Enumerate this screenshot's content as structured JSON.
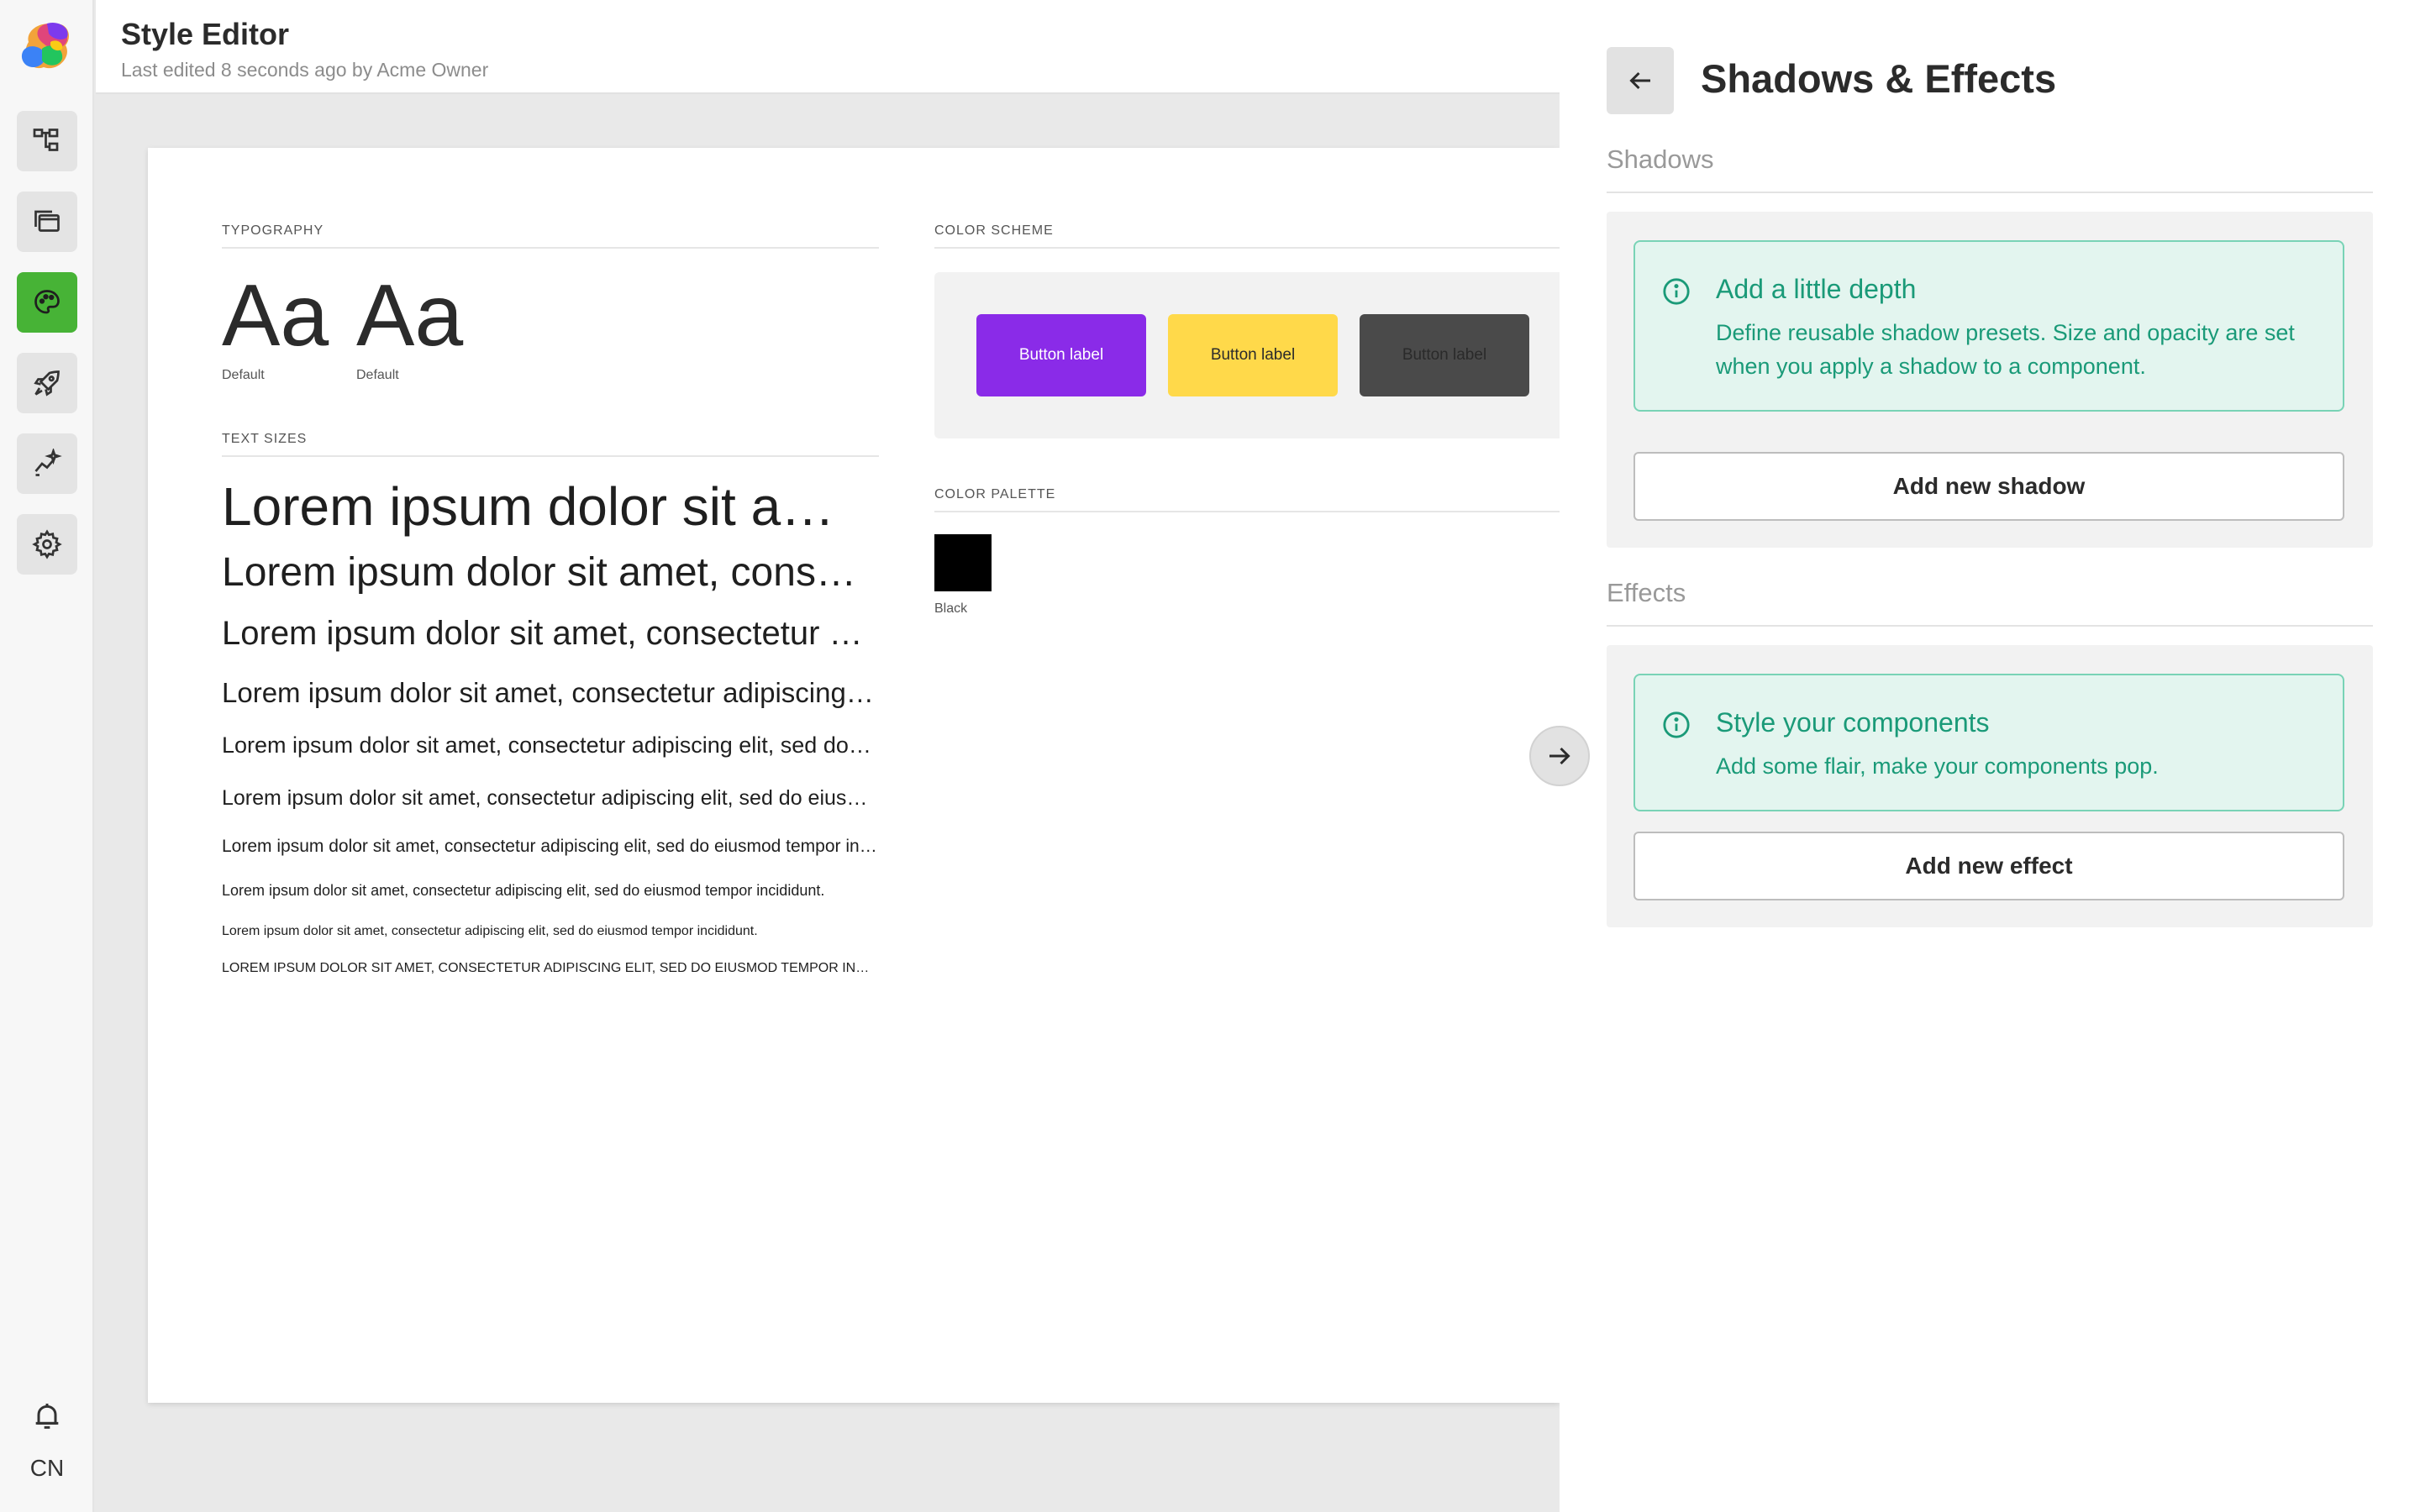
{
  "app": {
    "title": "Style Editor",
    "subtitle": "Last edited 8 seconds ago by Acme Owner"
  },
  "rail": {
    "items": [
      {
        "icon": "hierarchy-icon",
        "active": false
      },
      {
        "icon": "folders-icon",
        "active": false
      },
      {
        "icon": "palette-icon",
        "active": true
      },
      {
        "icon": "rocket-icon",
        "active": false
      },
      {
        "icon": "sparkle-chart-icon",
        "active": false
      },
      {
        "icon": "gear-icon",
        "active": false
      }
    ],
    "bottom_icon": "bell-icon",
    "user_initials": "CN"
  },
  "sheet": {
    "typography": {
      "label": "TYPOGRAPHY",
      "samples": [
        {
          "glyph": "Aa",
          "caption": "Default"
        },
        {
          "glyph": "Aa",
          "caption": "Default"
        }
      ]
    },
    "text_sizes": {
      "label": "TEXT SIZES",
      "lines": [
        "Lorem ipsum dolor sit amet, consectetur adipiscing elit, sed do eiusmod tempor incididunt.",
        "Lorem ipsum dolor sit amet, consectetur adipiscing elit, sed do eiusmod tempor incididunt.",
        "Lorem ipsum dolor sit amet, consectetur adipiscing elit, sed do eiusmod tempor incididunt.",
        "Lorem ipsum dolor sit amet, consectetur adipiscing elit, sed do eiusmod tempor incididunt.",
        "Lorem ipsum dolor sit amet, consectetur adipiscing elit, sed do eiusmod tempor incididunt.",
        "Lorem ipsum dolor sit amet, consectetur adipiscing elit, sed do eiusmod tempor incididunt.",
        "Lorem ipsum dolor sit amet, consectetur adipiscing elit, sed do eiusmod tempor incididunt.",
        "Lorem ipsum dolor sit amet, consectetur adipiscing elit, sed do eiusmod tempor incididunt.",
        "Lorem ipsum dolor sit amet, consectetur adipiscing elit, sed do eiusmod tempor incididunt.",
        "LOREM IPSUM DOLOR SIT AMET, CONSECTETUR ADIPISCING ELIT, SED DO EIUSMOD TEMPOR INCIDIDUNT."
      ]
    },
    "color_scheme": {
      "label": "COLOR SCHEME",
      "buttons": [
        {
          "label": "Button label",
          "bg": "#8a2be8",
          "fg": "#ffffff"
        },
        {
          "label": "Button label",
          "bg": "#ffd94a",
          "fg": "#2b2b2b"
        },
        {
          "label": "Button label",
          "bg": "#4a4a4a",
          "fg": "#2a2a2a"
        }
      ]
    },
    "color_palette": {
      "label": "COLOR PALETTE",
      "swatches": [
        {
          "name": "Black",
          "color": "#000000"
        }
      ]
    }
  },
  "panel": {
    "title": "Shadows & Effects",
    "shadows": {
      "label": "Shadows",
      "info_title": "Add a little depth",
      "info_text": "Define reusable shadow presets. Size and opacity are set when you apply a shadow to a component.",
      "button": "Add new shadow"
    },
    "effects": {
      "label": "Effects",
      "info_title": "Style your components",
      "info_text": "Add some flair, make your components pop.",
      "button": "Add new effect"
    }
  },
  "colors": {
    "accent_green": "#47b336",
    "info_teal": "#1a9a78"
  }
}
